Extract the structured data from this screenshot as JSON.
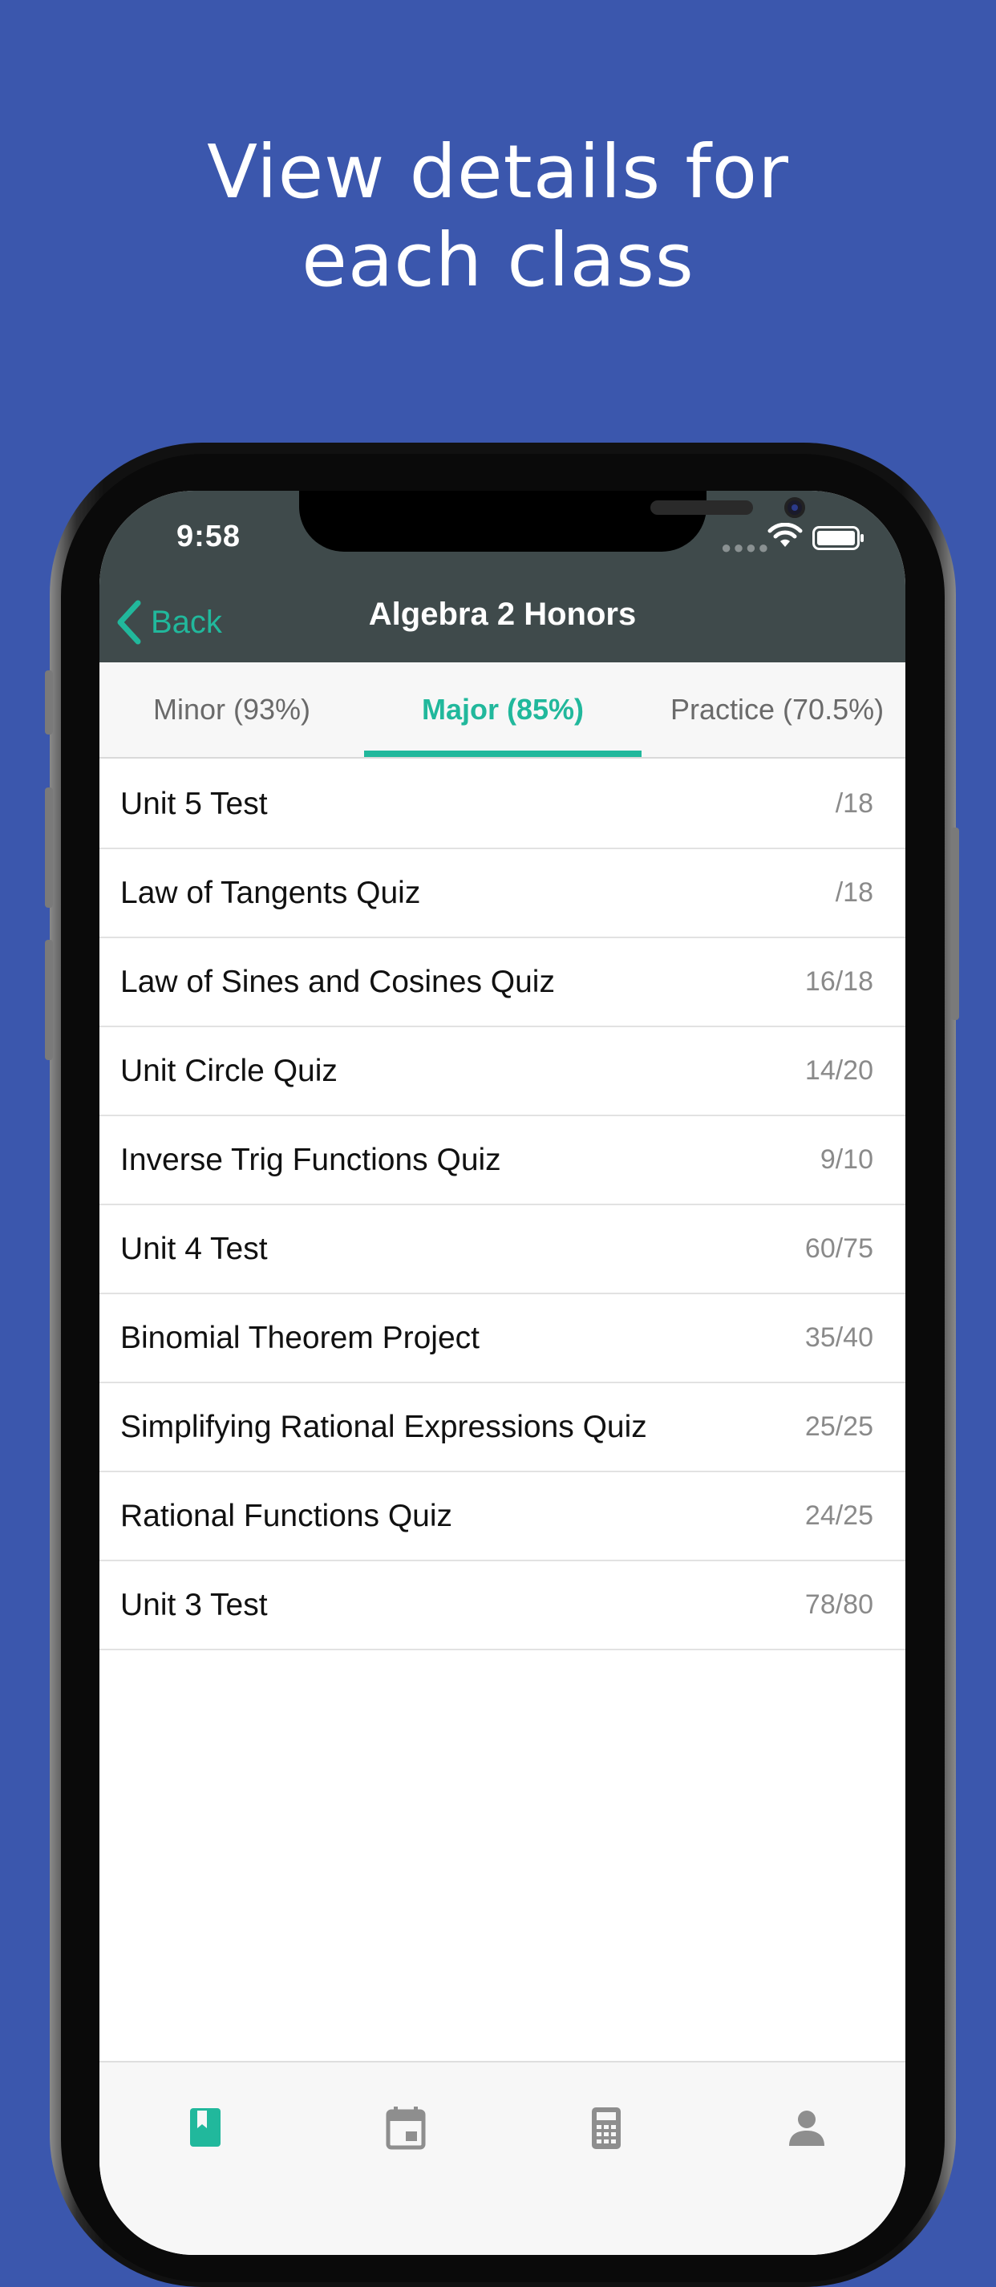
{
  "headline": {
    "line1": "View details for",
    "line2": "each class"
  },
  "status_bar": {
    "time": "9:58"
  },
  "nav": {
    "back_label": "Back",
    "title": "Algebra 2 Honors"
  },
  "tabs": [
    {
      "label": "Minor (93%)",
      "active": false
    },
    {
      "label": "Major (85%)",
      "active": true
    },
    {
      "label": "Practice (70.5%)",
      "active": false
    }
  ],
  "assignments": [
    {
      "title": "Unit 5 Test",
      "score": "/18"
    },
    {
      "title": "Law of Tangents Quiz",
      "score": "/18"
    },
    {
      "title": "Law of Sines and Cosines Quiz",
      "score": "16/18"
    },
    {
      "title": "Unit Circle Quiz",
      "score": "14/20"
    },
    {
      "title": "Inverse Trig Functions Quiz",
      "score": "9/10"
    },
    {
      "title": "Unit 4 Test",
      "score": "60/75"
    },
    {
      "title": "Binomial Theorem Project",
      "score": "35/40"
    },
    {
      "title": "Simplifying Rational Expressions Quiz",
      "score": "25/25"
    },
    {
      "title": "Rational Functions Quiz",
      "score": "24/25"
    },
    {
      "title": "Unit 3 Test",
      "score": "78/80"
    }
  ],
  "bottom_tabs": [
    {
      "icon": "book-icon",
      "active": true
    },
    {
      "icon": "calendar-icon",
      "active": false
    },
    {
      "icon": "calculator-icon",
      "active": false
    },
    {
      "icon": "person-icon",
      "active": false
    }
  ],
  "colors": {
    "background": "#3b57ad",
    "accent": "#21b89c",
    "nav_bar": "#3f4a4b",
    "inactive_icon": "#8e8e8e"
  }
}
